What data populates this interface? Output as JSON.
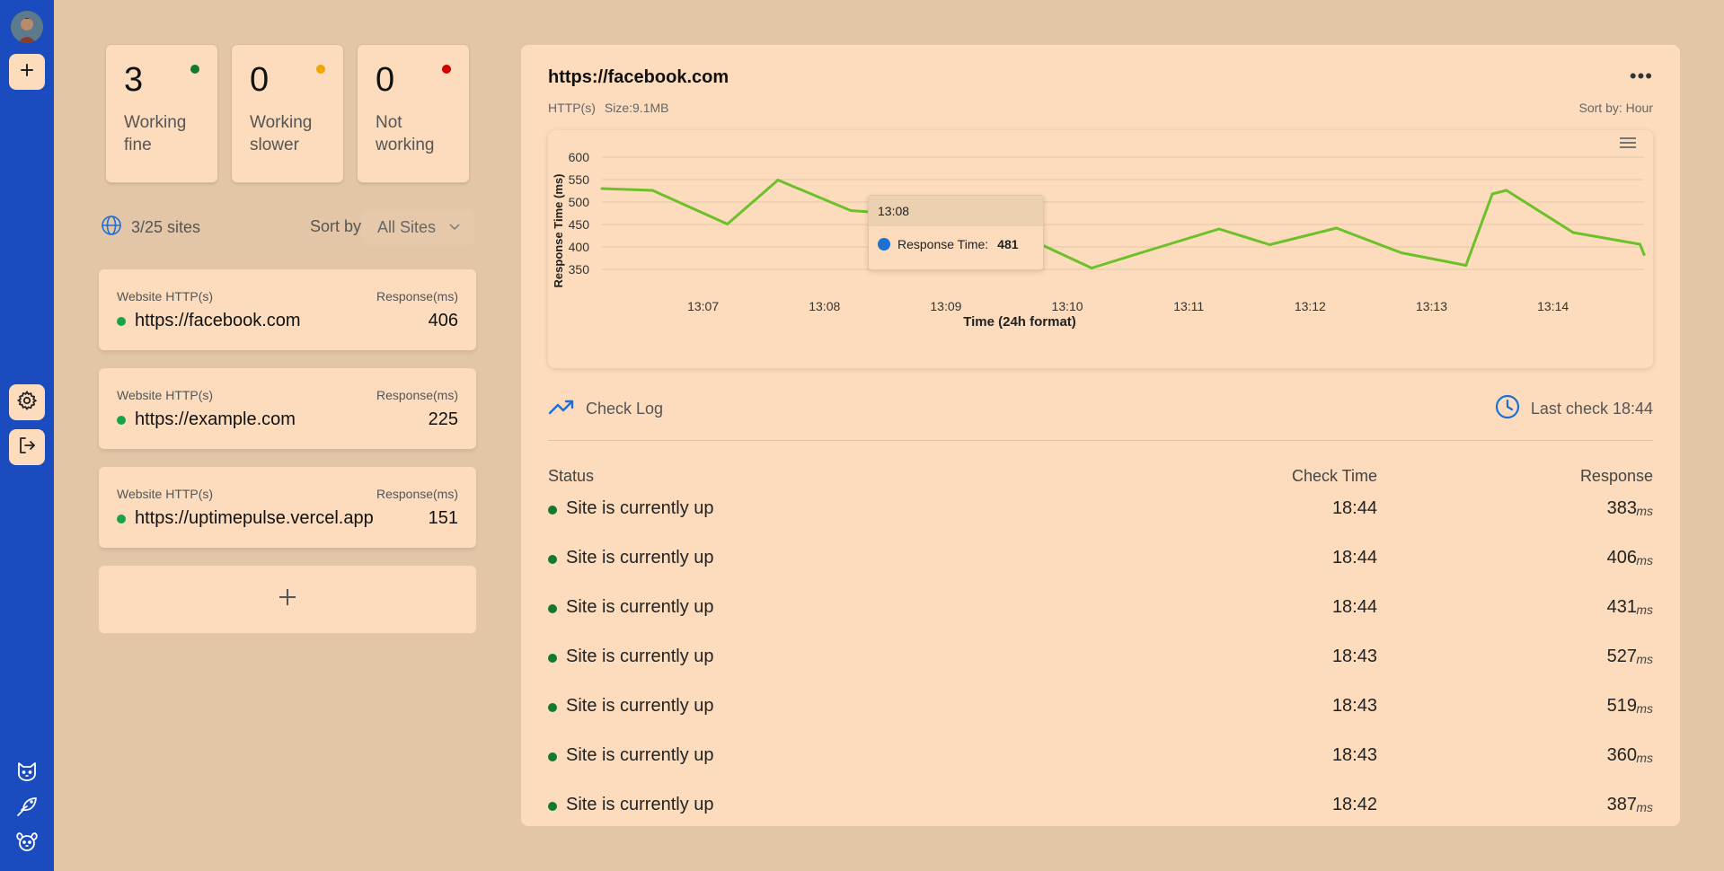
{
  "colors": {
    "sidebar": "#1a4bbf",
    "card": "#fcdcbc",
    "background": "#e2c6a7",
    "status_ok": "#137a2c",
    "status_slow": "#f0a500",
    "status_down": "#d10000",
    "chart_line": "#6cc12a",
    "accent_blue": "#1d6fd3"
  },
  "sidebar": {
    "top_icons": [
      "avatar",
      "plus-icon"
    ],
    "mid_icons": [
      "gear-icon",
      "logout-icon"
    ],
    "bottom_icons": [
      "cat-icon",
      "bird-icon",
      "dog-icon"
    ]
  },
  "stats": [
    {
      "count": "3",
      "label": "Working\nfine",
      "color": "#137a2c"
    },
    {
      "count": "0",
      "label": "Working\nslower",
      "color": "#f0a500"
    },
    {
      "count": "0",
      "label": "Not\nworking",
      "color": "#d10000"
    }
  ],
  "sites_header": {
    "count_text": "3/25 sites",
    "sort_label": "Sort by:",
    "sort_value": "All Sites"
  },
  "sites": [
    {
      "type": "Website HTTP(s)",
      "response_header": "Response(ms)",
      "url": "https://facebook.com",
      "response": "406"
    },
    {
      "type": "Website HTTP(s)",
      "response_header": "Response(ms)",
      "url": "https://example.com",
      "response": "225"
    },
    {
      "type": "Website HTTP(s)",
      "response_header": "Response(ms)",
      "url": "https://uptimepulse.vercel.app",
      "response": "151"
    }
  ],
  "add_site_symbol": "+",
  "detail": {
    "title": "https://facebook.com",
    "menu": "•••",
    "protocol": "HTTP(s)",
    "size": "Size:9.1MB",
    "sort": "Sort by: Hour"
  },
  "tooltip": {
    "time": "13:08",
    "label": "Response Time:",
    "value": "481"
  },
  "chart_data": {
    "type": "line",
    "xlabel": "Time (24h format)",
    "ylabel": "Response Time (ms)",
    "ylim": [
      350,
      600
    ],
    "yticks": [
      "350",
      "400",
      "450",
      "500",
      "550",
      "600"
    ],
    "xticks": [
      "13:07",
      "13:08",
      "13:09",
      "13:10",
      "13:11",
      "13:12",
      "13:13",
      "13:14"
    ],
    "xrange": [
      "13:06:10",
      "13:14:45"
    ],
    "grid": true,
    "series": [
      {
        "x": [
          "13:06:10",
          "13:06:35",
          "13:07:12",
          "13:07:37",
          "13:08:13",
          "13:08:35",
          "13:09:05",
          "13:09:40",
          "13:10:12",
          "13:10:40",
          "13:11:15",
          "13:11:40",
          "13:12:13",
          "13:12:45",
          "13:13:17",
          "13:13:30",
          "13:13:37",
          "13:14:10",
          "13:14:43",
          "13:14:45"
        ],
        "y": [
          530,
          526,
          451,
          549,
          481,
          474,
          470,
          420,
          353,
          392,
          440,
          405,
          442,
          387,
          359,
          518,
          526,
          432,
          406,
          383
        ]
      }
    ]
  },
  "log": {
    "title": "Check Log",
    "last_check": "Last check 18:44",
    "headers": {
      "status": "Status",
      "time": "Check Time",
      "response": "Response"
    },
    "unit": "ms",
    "rows": [
      {
        "status": "Site is currently up",
        "time": "18:44",
        "response": "383"
      },
      {
        "status": "Site is currently up",
        "time": "18:44",
        "response": "406"
      },
      {
        "status": "Site is currently up",
        "time": "18:44",
        "response": "431"
      },
      {
        "status": "Site is currently up",
        "time": "18:43",
        "response": "527"
      },
      {
        "status": "Site is currently up",
        "time": "18:43",
        "response": "519"
      },
      {
        "status": "Site is currently up",
        "time": "18:43",
        "response": "360"
      },
      {
        "status": "Site is currently up",
        "time": "18:42",
        "response": "387"
      }
    ]
  }
}
